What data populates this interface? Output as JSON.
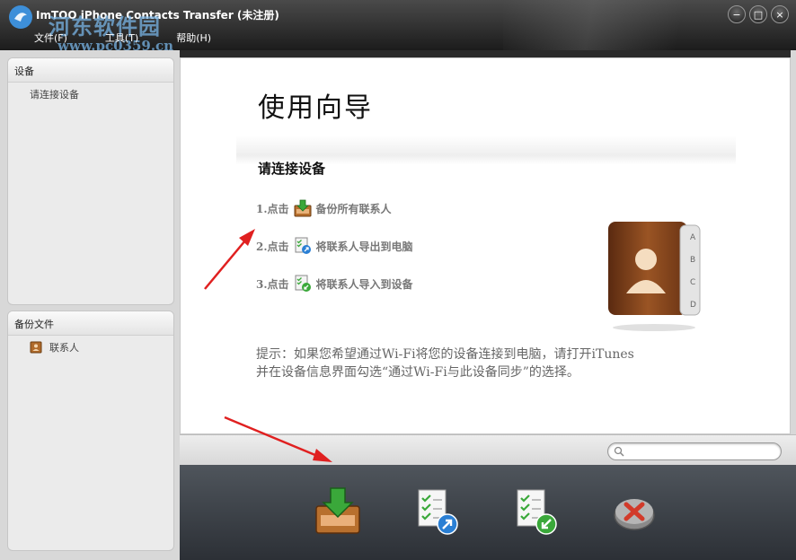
{
  "window": {
    "title": "ImTOO iPhone Contacts Transfer (未注册)",
    "watermark": "河东软件园",
    "watermark_url": "www.pc0359.cn",
    "menu": [
      "文件(F)",
      "工具(T)",
      "帮助(H)"
    ],
    "controls": [
      "−",
      "□",
      "×"
    ]
  },
  "sidebar": {
    "devices": {
      "header": "设备",
      "items": [
        "请连接设备"
      ]
    },
    "backup": {
      "header": "备份文件",
      "items": [
        "联系人"
      ]
    }
  },
  "wizard": {
    "title": "使用向导",
    "subtitle": "请连接设备",
    "steps": [
      {
        "prefix": "1.点击",
        "text": "备份所有联系人",
        "icon": "backup-tray-icon"
      },
      {
        "prefix": "2.点击",
        "text": "将联系人导出到电脑",
        "icon": "export-list-icon"
      },
      {
        "prefix": "3.点击",
        "text": "将联系人导入到设备",
        "icon": "import-list-icon"
      }
    ],
    "hint_line1": "提示：如果您希望通过Wi-Fi将您的设备连接到电脑，请打开iTunes",
    "hint_line2": "并在设备信息界面勾选“通过Wi-Fi与此设备同步”的选择。",
    "book_tabs": [
      "A",
      "B",
      "C",
      "D"
    ]
  },
  "search": {
    "placeholder": ""
  },
  "toolbar": {
    "buttons": [
      "backup-tray-icon",
      "export-list-icon",
      "import-list-icon",
      "cancel-icon"
    ]
  },
  "colors": {
    "arrow": "#e02020",
    "toolbar": "#3a3f45",
    "accent_green": "#3aa83a",
    "accent_blue": "#2a7fd4"
  }
}
